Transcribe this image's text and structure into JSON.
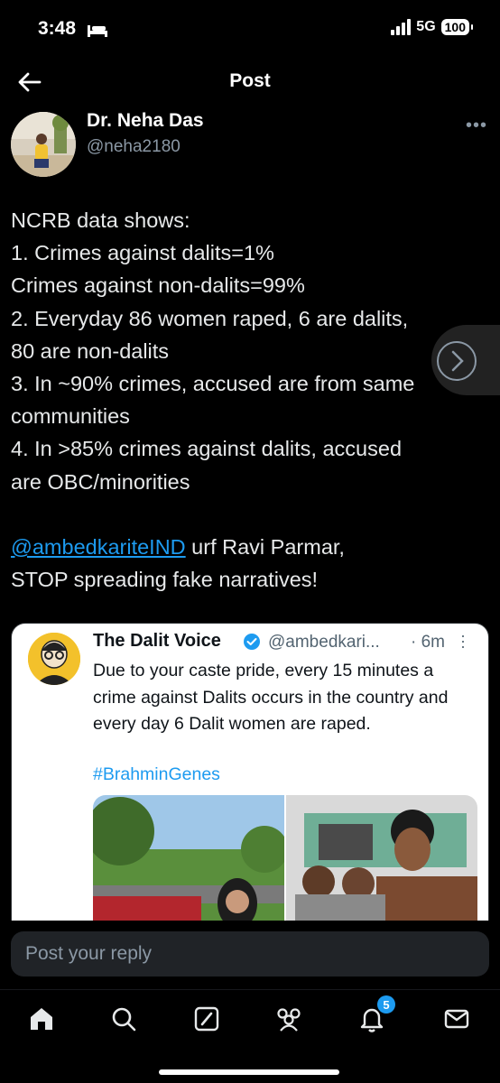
{
  "status_bar": {
    "time": "3:48",
    "network": "5G",
    "battery": "100"
  },
  "header": {
    "title": "Post"
  },
  "author": {
    "display_name": "Dr. Neha Das",
    "handle": "@neha2180"
  },
  "post": {
    "text_intro": "NCRB data shows:\n1. Crimes against dalits=1%\nCrimes against non-dalits=99%\n2. Everyday 86 women raped, 6 are dalits,\n80 are non-dalits\n3. In ~90% crimes, accused are from same\ncommunities\n4. In >85% crimes against dalits, accused\nare OBC/minorities\n\n",
    "mention": "@ambedkariteIND",
    "text_after_mention": " urf Ravi Parmar,\nSTOP spreading fake narratives!"
  },
  "quote": {
    "name": "The Dalit Voice",
    "handle": "@ambedkari...",
    "time": "· 6m",
    "text": "Due to your caste pride, every 15 minutes a crime against Dalits occurs in the country and every day 6 Dalit women are raped.",
    "hashtag": "#BrahminGenes"
  },
  "reply": {
    "placeholder": "Post your reply"
  },
  "nav": {
    "notifications_badge": "5"
  },
  "colors": {
    "accent": "#1d9bf0",
    "background": "#000000",
    "text": "#e7e9ea",
    "muted": "#8b98a5"
  },
  "icons": [
    "back-arrow-icon",
    "more-icon",
    "verified-icon",
    "home-icon",
    "search-icon",
    "compose-icon",
    "communities-icon",
    "bell-icon",
    "mail-icon"
  ]
}
